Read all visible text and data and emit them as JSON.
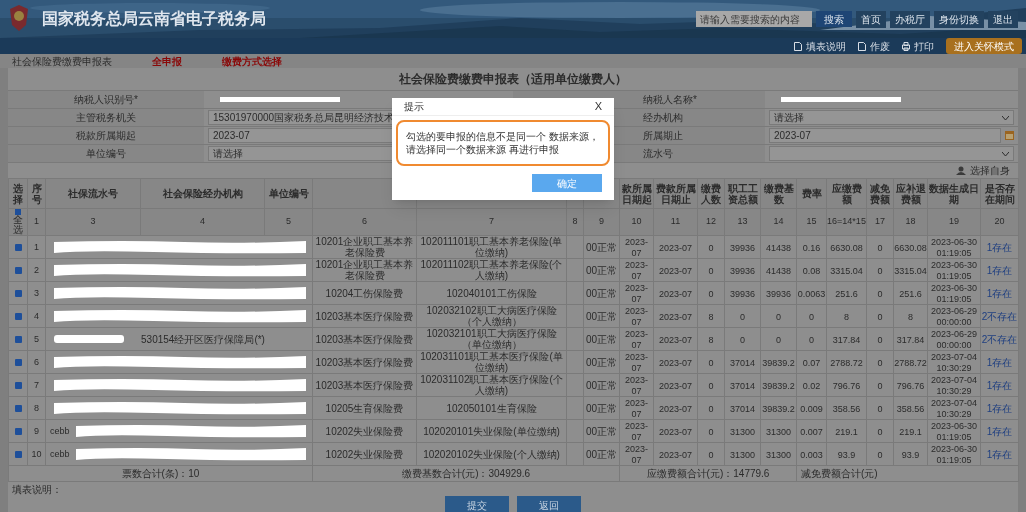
{
  "header": {
    "title": "国家税务总局云南省电子税务局",
    "search": {
      "placeholder": "请输入需要搜索的内容"
    },
    "search_button": "搜索",
    "links": [
      "首页",
      "办税厅",
      "身份切换",
      "退出"
    ]
  },
  "toolbar": {
    "actions": [
      {
        "label": "填表说明",
        "kind": "doc"
      },
      {
        "label": "作废",
        "kind": "void"
      },
      {
        "label": "打印",
        "kind": "print"
      }
    ],
    "mode_button": "进入关怀模式"
  },
  "breadcrumb": {
    "page": "社会保险费缴费申报表",
    "links": [
      "全申报",
      "缴费方式选择"
    ]
  },
  "form": {
    "title": "社会保险费缴费申报表（适用单位缴费人）",
    "rows": [
      {
        "left": {
          "label": "纳税人识别号*",
          "kind": "redacted"
        },
        "right": {
          "label": "纳税人名称*",
          "kind": "redacted"
        }
      },
      {
        "left": {
          "label": "主管税务机关",
          "kind": "text",
          "value": "15301970000国家税务总局昆明经济技术"
        },
        "right": {
          "label": "经办机构",
          "kind": "select",
          "value": "请选择"
        }
      },
      {
        "left": {
          "label": "税款所属期起",
          "kind": "text",
          "value": "2023-07"
        },
        "right": {
          "label": "所属期止",
          "kind": "date",
          "value": "2023-07"
        }
      },
      {
        "left": {
          "label": "单位编号",
          "kind": "text",
          "value": "请选择"
        },
        "right": {
          "label": "流水号",
          "kind": "select"
        }
      }
    ],
    "side_button": "选择自身"
  },
  "table": {
    "select_all": {
      "label": "全选",
      "checked": true
    },
    "columns": [
      {
        "label": "选择"
      },
      {
        "label": "序号",
        "number": "1"
      },
      {
        "label": "社保流水号",
        "number": "3"
      },
      {
        "label": "社会保险经办机构",
        "number": "4"
      },
      {
        "label": "单位编号",
        "number": "5"
      },
      {
        "number": "6"
      },
      {
        "number": "7"
      },
      {
        "number": "8"
      },
      {
        "number": "9"
      },
      {
        "label": "款所属日期起",
        "number": "10"
      },
      {
        "label": "费款所属日期止",
        "number": "11"
      },
      {
        "label": "缴费人数",
        "number": "12"
      },
      {
        "label": "职工工资总额",
        "number": "13"
      },
      {
        "label": "缴费基数",
        "number": "14"
      },
      {
        "label": "费率",
        "number": "15"
      },
      {
        "label": "应缴费额",
        "number": "16=14*15"
      },
      {
        "label": "减免费额",
        "number": "17"
      },
      {
        "label": "应补退费额",
        "number": "18"
      },
      {
        "label": "数据生成日期",
        "number": "19"
      },
      {
        "label": "是否存在期间",
        "number": "20"
      }
    ],
    "rows": [
      {
        "checked": true,
        "no": "1",
        "redacted": true,
        "type": "10201企业职工基本养老保险费",
        "item": "102011101职工基本养老保险(单位缴纳)",
        "status": "00正常",
        "from": "2023-07",
        "to": "2023-07",
        "people": "0",
        "wages": "39936",
        "base": "41438",
        "rate": "0.16",
        "due": "6630.08",
        "relief": "0",
        "refund": "6630.08",
        "date": "2023-06-30 01:19:05",
        "exists": "1存在"
      },
      {
        "checked": true,
        "no": "2",
        "redacted": true,
        "type": "10201企业职工基本养老保险费",
        "item": "102011102职工基本养老保险(个人缴纳)",
        "status": "00正常",
        "from": "2023-07",
        "to": "2023-07",
        "people": "0",
        "wages": "39936",
        "base": "41438",
        "rate": "0.08",
        "due": "3315.04",
        "relief": "0",
        "refund": "3315.04",
        "date": "2023-06-30 01:19:05",
        "exists": "1存在"
      },
      {
        "checked": true,
        "no": "3",
        "redacted": true,
        "type": "10204工伤保险费",
        "item": "102040101工伤保险",
        "status": "00正常",
        "from": "2023-07",
        "to": "2023-07",
        "people": "0",
        "wages": "39936",
        "base": "39936",
        "rate": "0.0063",
        "due": "251.6",
        "relief": "0",
        "refund": "251.6",
        "date": "2023-06-30 01:19:05",
        "exists": "1存在"
      },
      {
        "checked": true,
        "no": "4",
        "redacted": true,
        "type": "10203基本医疗保险费",
        "item": "102032102职工大病医疗保险（个人缴纳）",
        "status": "00正常",
        "from": "2023-07",
        "to": "2023-07",
        "people": "8",
        "wages": "0",
        "base": "0",
        "rate": "0",
        "due": "8",
        "relief": "0",
        "refund": "8",
        "date": "2023-06-29 00:00:00",
        "exists": "2不存在"
      },
      {
        "checked": true,
        "no": "5",
        "redacted": true,
        "agency": "530154经开区医疗保障局(*)",
        "type": "10203基本医疗保险费",
        "item": "102032101职工大病医疗保险（单位缴纳）",
        "status": "00正常",
        "from": "2023-07",
        "to": "2023-07",
        "people": "8",
        "wages": "0",
        "base": "0",
        "rate": "0",
        "due": "317.84",
        "relief": "0",
        "refund": "317.84",
        "date": "2023-06-29 00:00:00",
        "exists": "2不存在"
      },
      {
        "checked": true,
        "no": "6",
        "redacted": true,
        "type": "10203基本医疗保险费",
        "item": "102031101职工基本医疗保险(单位缴纳)",
        "status": "00正常",
        "from": "2023-07",
        "to": "2023-07",
        "people": "0",
        "wages": "37014",
        "base": "39839.2",
        "rate": "0.07",
        "due": "2788.72",
        "relief": "0",
        "refund": "2788.72",
        "date": "2023-07-04 10:30:29",
        "exists": "1存在"
      },
      {
        "checked": true,
        "no": "7",
        "redacted": true,
        "type": "10203基本医疗保险费",
        "item": "102031102职工基本医疗保险(个人缴纳)",
        "status": "00正常",
        "from": "2023-07",
        "to": "2023-07",
        "people": "0",
        "wages": "37014",
        "base": "39839.2",
        "rate": "0.02",
        "due": "796.76",
        "relief": "0",
        "refund": "796.76",
        "date": "2023-07-04 10:30:29",
        "exists": "1存在"
      },
      {
        "checked": true,
        "no": "8",
        "redacted": true,
        "type": "10205生育保险费",
        "item": "102050101生育保险",
        "status": "00正常",
        "from": "2023-07",
        "to": "2023-07",
        "people": "0",
        "wages": "37014",
        "base": "39839.2",
        "rate": "0.009",
        "due": "358.56",
        "relief": "0",
        "refund": "358.56",
        "date": "2023-07-04 10:30:29",
        "exists": "1存在"
      },
      {
        "checked": true,
        "no": "9",
        "redacted": true,
        "serial": "cebb",
        "type": "10202失业保险费",
        "item": "102020101失业保险(单位缴纳)",
        "status": "00正常",
        "from": "2023-07",
        "to": "2023-07",
        "people": "0",
        "wages": "31300",
        "base": "31300",
        "rate": "0.007",
        "due": "219.1",
        "relief": "0",
        "refund": "219.1",
        "date": "2023-06-30 01:19:05",
        "exists": "1存在"
      },
      {
        "checked": true,
        "no": "10",
        "redacted": true,
        "serial": "cebb",
        "type": "10202失业保险费",
        "item": "102020102失业保险(个人缴纳)",
        "status": "00正常",
        "from": "2023-07",
        "to": "2023-07",
        "people": "0",
        "wages": "31300",
        "base": "31300",
        "rate": "0.003",
        "due": "93.9",
        "relief": "0",
        "refund": "93.9",
        "date": "2023-06-30 01:19:05",
        "exists": "1存在"
      }
    ],
    "totals": [
      "票数合计(条)：10",
      "缴费基数合计(元)：304929.6",
      "应缴费额合计(元)：14779.6",
      "减免费额合计(元)"
    ]
  },
  "notes_label": "填表说明：",
  "buttons": [
    "提交",
    "返回"
  ],
  "dialog": {
    "title": "提示",
    "close": "X",
    "message": "勾选的要申报的信息不是同一个 数据来源，请选择同一个数据来源 再进行申报",
    "highlighted": true,
    "confirm": "确定"
  }
}
